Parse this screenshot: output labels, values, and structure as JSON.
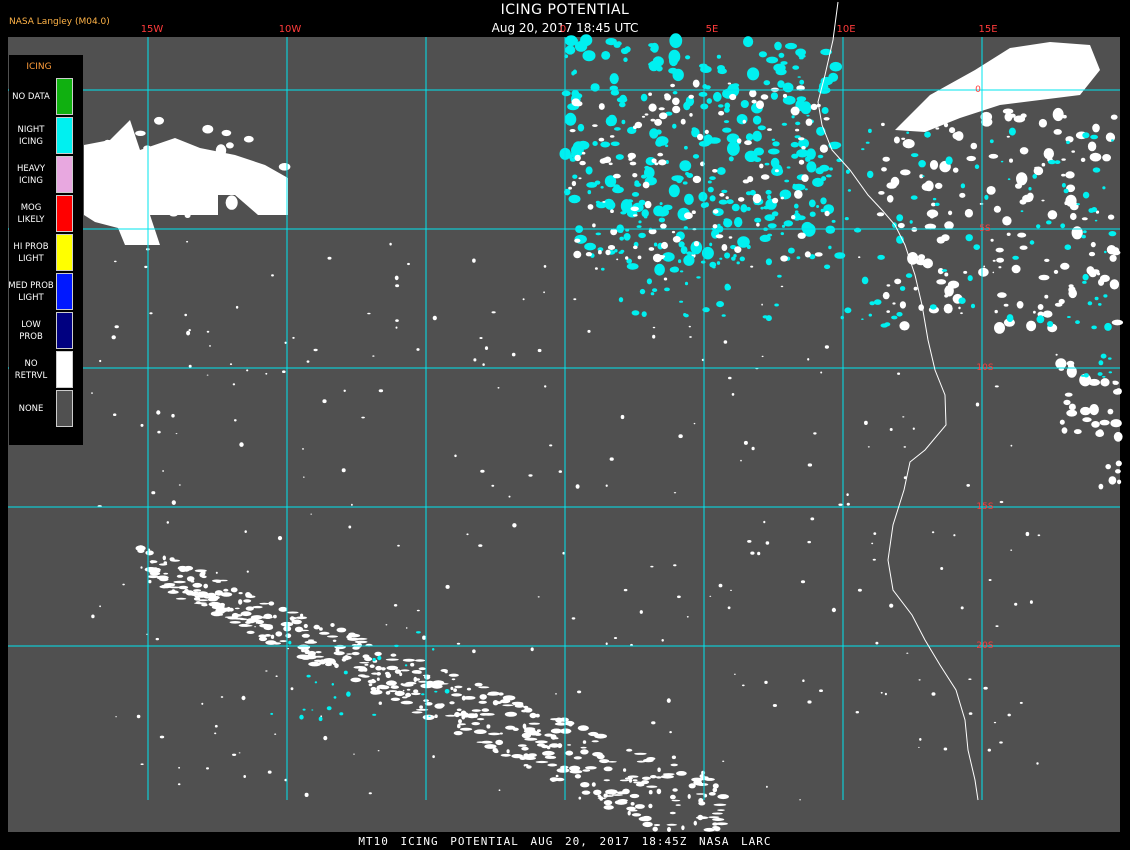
{
  "header": {
    "org": "NASA Langley (M04.0)",
    "title": "ICING POTENTIAL",
    "datetime": "Aug 20, 2017 18:45 UTC"
  },
  "grid": {
    "lon_labels": [
      "15W",
      "10W",
      "0",
      "5E",
      "10E",
      "15E"
    ],
    "lat_labels": [
      "0",
      "5S",
      "10S",
      "15S",
      "20S"
    ]
  },
  "legend": {
    "title": "ICING",
    "items": [
      {
        "label": "NO DATA",
        "color": "#10b010"
      },
      {
        "label": "NIGHT\nICING",
        "color": "#00f0f0"
      },
      {
        "label": "HEAVY\nICING",
        "color": "#e8a8e0"
      },
      {
        "label": "MOG\nLIKELY",
        "color": "#ff0000"
      },
      {
        "label": "HI PROB\nLIGHT",
        "color": "#ffff00"
      },
      {
        "label": "MED PROB\nLIGHT",
        "color": "#0018ff"
      },
      {
        "label": "LOW\nPROB",
        "color": "#000080"
      },
      {
        "label": "NO\nRETRVL",
        "color": "#ffffff"
      },
      {
        "label": "NONE",
        "color": "#505050"
      }
    ]
  },
  "footer": "MT10 ICING POTENTIAL AUG 20, 2017 18:45Z NASA LARC",
  "colors": {
    "background": "#505050",
    "grid": "#00e5ee",
    "coast": "#ffffff",
    "labels": "#ff3b3b"
  }
}
